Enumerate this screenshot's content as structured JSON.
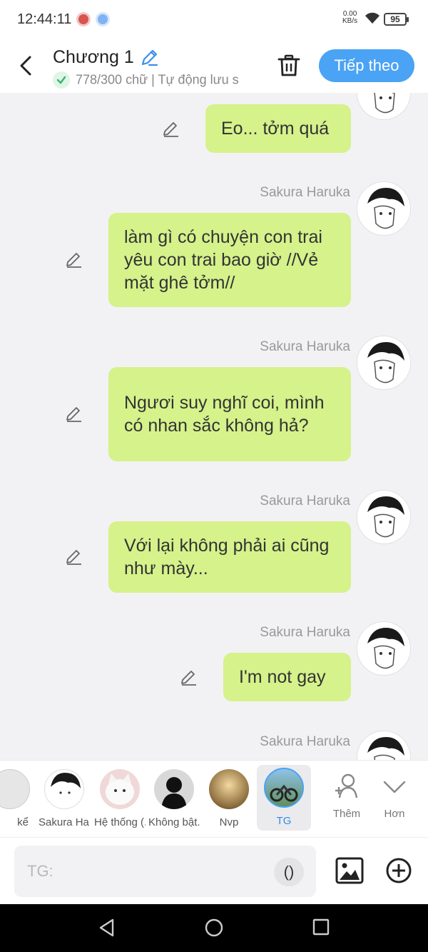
{
  "status": {
    "time": "12:44:11",
    "net_speed": "0.00",
    "net_unit": "KB/s",
    "battery": "95"
  },
  "header": {
    "title": "Chương 1",
    "word_count": "778/300 chữ",
    "autosave": "| Tự động lưu s",
    "next_label": "Tiếp theo"
  },
  "messages": [
    {
      "sender": "",
      "text": "Eo... tởm quá"
    },
    {
      "sender": "Sakura Haruka",
      "text": "làm gì có chuyện con trai yêu con trai bao giờ //Vẻ mặt ghê tởm//"
    },
    {
      "sender": "Sakura Haruka",
      "text": "Ngươi suy nghĩ coi, mình có nhan sắc không hả?"
    },
    {
      "sender": "Sakura Haruka",
      "text": "Với lại không phải ai cũng như mày..."
    },
    {
      "sender": "Sakura Haruka",
      "text": "I'm not gay"
    },
    {
      "sender": "Sakura Haruka",
      "text": ""
    }
  ],
  "characters": [
    {
      "name": "kể",
      "icon": "narrator-icon"
    },
    {
      "name": "Sakura Ha...",
      "icon": "manga-avatar"
    },
    {
      "name": "Hệ thống (...",
      "icon": "cat-avatar"
    },
    {
      "name": "Không bật...",
      "icon": "silhouette-avatar"
    },
    {
      "name": "Nvp",
      "icon": "light-avatar"
    },
    {
      "name": "TG",
      "icon": "bike-avatar"
    }
  ],
  "strip_buttons": {
    "add_label": "Thêm",
    "more_label": "Hơn"
  },
  "input": {
    "placeholder": "TG:",
    "paren_label": "()"
  }
}
